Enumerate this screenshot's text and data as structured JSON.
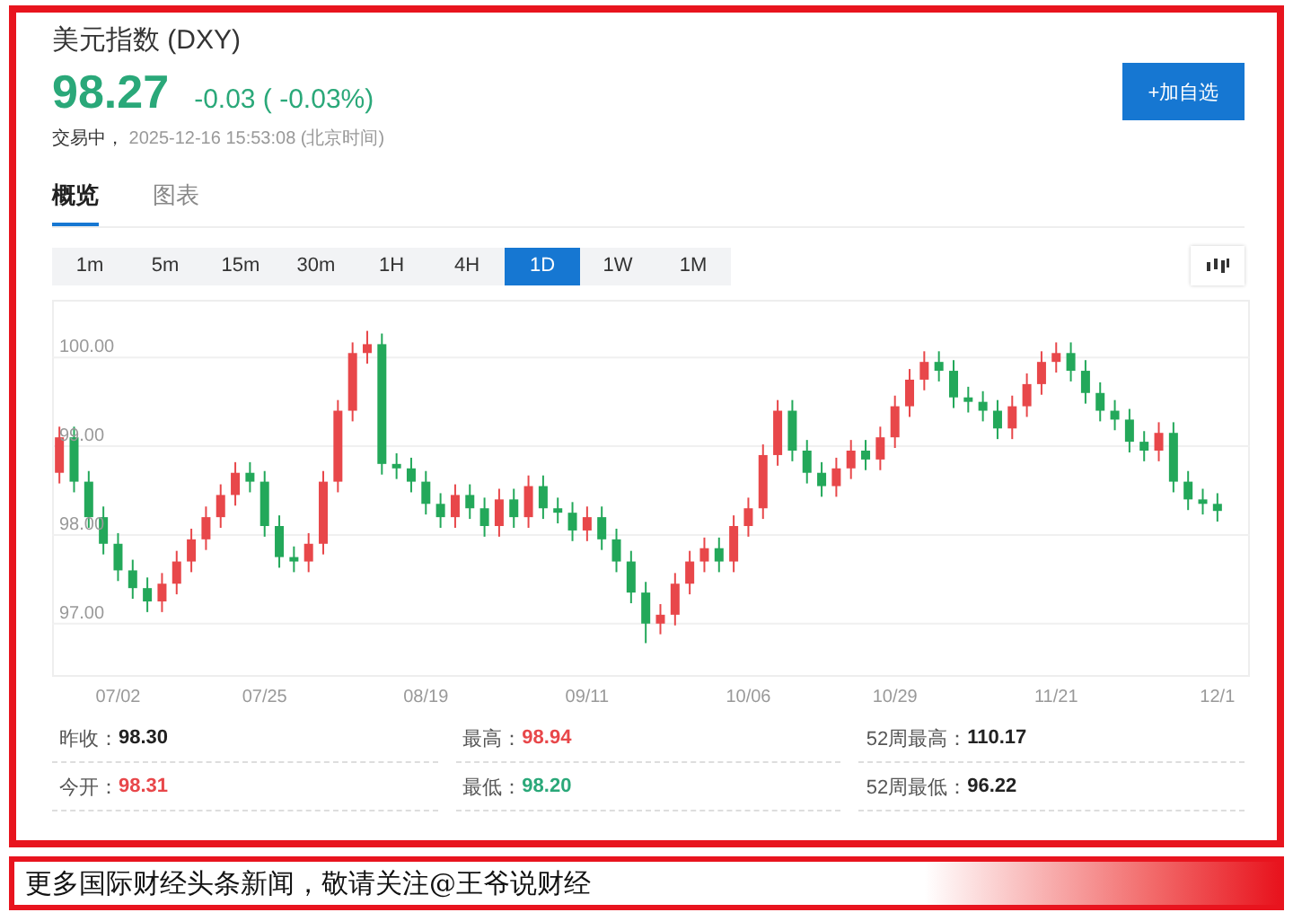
{
  "header": {
    "title": "美元指数 (DXY)",
    "price": "98.27",
    "change": "-0.03 ( -0.03%)",
    "status": "交易中，",
    "timestamp": "2025-12-16 15:53:08 (北京时间)",
    "add_button": "+加自选"
  },
  "tabs": [
    {
      "label": "概览",
      "selected": true
    },
    {
      "label": "图表",
      "selected": false
    }
  ],
  "periods": [
    {
      "label": "1m",
      "selected": false
    },
    {
      "label": "5m",
      "selected": false
    },
    {
      "label": "15m",
      "selected": false
    },
    {
      "label": "30m",
      "selected": false
    },
    {
      "label": "1H",
      "selected": false
    },
    {
      "label": "4H",
      "selected": false
    },
    {
      "label": "1D",
      "selected": true
    },
    {
      "label": "1W",
      "selected": false
    },
    {
      "label": "1M",
      "selected": false
    }
  ],
  "chart": {
    "chart_data": {
      "type": "candlestick",
      "ylim": [
        96.4,
        100.65
      ],
      "grid": true,
      "categories": [
        null,
        null,
        null,
        null,
        "07/02",
        null,
        null,
        null,
        null,
        null,
        null,
        null,
        null,
        null,
        "07/25",
        null,
        null,
        null,
        null,
        null,
        null,
        null,
        null,
        null,
        null,
        "08/19",
        null,
        null,
        null,
        null,
        null,
        null,
        null,
        null,
        null,
        null,
        "09/11",
        null,
        null,
        null,
        null,
        null,
        null,
        null,
        null,
        null,
        null,
        "10/06",
        null,
        null,
        null,
        null,
        null,
        null,
        null,
        null,
        null,
        "10/29",
        null,
        null,
        null,
        null,
        null,
        null,
        null,
        null,
        null,
        null,
        "11/21",
        null,
        null,
        null,
        null,
        null,
        null,
        null,
        null,
        null,
        null,
        "12/1"
      ],
      "ohlc": [
        [
          98.7,
          99.22,
          98.58,
          99.1
        ],
        [
          99.1,
          99.22,
          98.48,
          98.6
        ],
        [
          98.6,
          98.72,
          98.08,
          98.2
        ],
        [
          98.2,
          98.32,
          97.78,
          97.9
        ],
        [
          97.9,
          98.02,
          97.48,
          97.6
        ],
        [
          97.6,
          97.72,
          97.28,
          97.4
        ],
        [
          97.4,
          97.52,
          97.13,
          97.25
        ],
        [
          97.25,
          97.57,
          97.13,
          97.45
        ],
        [
          97.45,
          97.82,
          97.33,
          97.7
        ],
        [
          97.7,
          98.07,
          97.58,
          97.95
        ],
        [
          97.95,
          98.32,
          97.83,
          98.2
        ],
        [
          98.2,
          98.57,
          98.08,
          98.45
        ],
        [
          98.45,
          98.82,
          98.33,
          98.7
        ],
        [
          98.7,
          98.82,
          98.48,
          98.6
        ],
        [
          98.6,
          98.72,
          97.98,
          98.1
        ],
        [
          98.1,
          98.22,
          97.63,
          97.75
        ],
        [
          97.75,
          97.87,
          97.58,
          97.7
        ],
        [
          97.7,
          98.02,
          97.58,
          97.9
        ],
        [
          97.9,
          98.72,
          97.78,
          98.6
        ],
        [
          98.6,
          99.52,
          98.48,
          99.4
        ],
        [
          99.4,
          100.17,
          99.28,
          100.05
        ],
        [
          100.05,
          100.3,
          99.93,
          100.15
        ],
        [
          100.15,
          100.27,
          98.68,
          98.8
        ],
        [
          98.8,
          98.92,
          98.63,
          98.75
        ],
        [
          98.75,
          98.87,
          98.48,
          98.6
        ],
        [
          98.6,
          98.72,
          98.23,
          98.35
        ],
        [
          98.35,
          98.47,
          98.08,
          98.2
        ],
        [
          98.2,
          98.57,
          98.08,
          98.45
        ],
        [
          98.45,
          98.57,
          98.18,
          98.3
        ],
        [
          98.3,
          98.42,
          97.98,
          98.1
        ],
        [
          98.1,
          98.52,
          97.98,
          98.4
        ],
        [
          98.4,
          98.52,
          98.08,
          98.2
        ],
        [
          98.2,
          98.67,
          98.08,
          98.55
        ],
        [
          98.55,
          98.67,
          98.18,
          98.3
        ],
        [
          98.3,
          98.42,
          98.13,
          98.25
        ],
        [
          98.25,
          98.37,
          97.93,
          98.05
        ],
        [
          98.05,
          98.32,
          97.93,
          98.2
        ],
        [
          98.2,
          98.32,
          97.83,
          97.95
        ],
        [
          97.95,
          98.07,
          97.58,
          97.7
        ],
        [
          97.7,
          97.82,
          97.23,
          97.35
        ],
        [
          97.35,
          97.47,
          96.78,
          97.0
        ],
        [
          97.0,
          97.22,
          96.88,
          97.1
        ],
        [
          97.1,
          97.57,
          96.98,
          97.45
        ],
        [
          97.45,
          97.82,
          97.33,
          97.7
        ],
        [
          97.7,
          97.97,
          97.58,
          97.85
        ],
        [
          97.85,
          97.97,
          97.58,
          97.7
        ],
        [
          97.7,
          98.22,
          97.58,
          98.1
        ],
        [
          98.1,
          98.42,
          97.98,
          98.3
        ],
        [
          98.3,
          99.02,
          98.18,
          98.9
        ],
        [
          98.9,
          99.52,
          98.78,
          99.4
        ],
        [
          99.4,
          99.52,
          98.83,
          98.95
        ],
        [
          98.95,
          99.07,
          98.58,
          98.7
        ],
        [
          98.7,
          98.82,
          98.43,
          98.55
        ],
        [
          98.55,
          98.87,
          98.43,
          98.75
        ],
        [
          98.75,
          99.07,
          98.63,
          98.95
        ],
        [
          98.95,
          99.07,
          98.73,
          98.85
        ],
        [
          98.85,
          99.22,
          98.73,
          99.1
        ],
        [
          99.1,
          99.57,
          98.98,
          99.45
        ],
        [
          99.45,
          99.87,
          99.33,
          99.75
        ],
        [
          99.75,
          100.07,
          99.63,
          99.95
        ],
        [
          99.95,
          100.07,
          99.73,
          99.85
        ],
        [
          99.85,
          99.97,
          99.43,
          99.55
        ],
        [
          99.55,
          99.67,
          99.38,
          99.5
        ],
        [
          99.5,
          99.62,
          99.28,
          99.4
        ],
        [
          99.4,
          99.52,
          99.08,
          99.2
        ],
        [
          99.2,
          99.57,
          99.08,
          99.45
        ],
        [
          99.45,
          99.82,
          99.33,
          99.7
        ],
        [
          99.7,
          100.07,
          99.58,
          99.95
        ],
        [
          99.95,
          100.17,
          99.83,
          100.05
        ],
        [
          100.05,
          100.17,
          99.73,
          99.85
        ],
        [
          99.85,
          99.97,
          99.48,
          99.6
        ],
        [
          99.6,
          99.72,
          99.28,
          99.4
        ],
        [
          99.4,
          99.52,
          99.18,
          99.3
        ],
        [
          99.3,
          99.42,
          98.93,
          99.05
        ],
        [
          99.05,
          99.17,
          98.83,
          98.95
        ],
        [
          98.95,
          99.27,
          98.83,
          99.15
        ],
        [
          99.15,
          99.27,
          98.48,
          98.6
        ],
        [
          98.6,
          98.72,
          98.28,
          98.4
        ],
        [
          98.4,
          98.52,
          98.23,
          98.35
        ],
        [
          98.35,
          98.47,
          98.15,
          98.27
        ]
      ],
      "yticks": [
        {
          "value": 100,
          "label": "100.00"
        },
        {
          "value": 99,
          "label": "99.00"
        },
        {
          "value": 98,
          "label": "98.00"
        },
        {
          "value": 97,
          "label": "97.00"
        }
      ]
    }
  },
  "stats": [
    {
      "label": "昨收：",
      "value": "98.30",
      "color": "#222222"
    },
    {
      "label": "最高：",
      "value": "98.94",
      "color": "#e8474a"
    },
    {
      "label": "52周最高：",
      "value": "110.17",
      "color": "#222222"
    },
    {
      "label": "今开：",
      "value": "98.31",
      "color": "#e8474a"
    },
    {
      "label": "最低：",
      "value": "98.20",
      "color": "#2aa879"
    },
    {
      "label": "52周最低：",
      "value": "96.22",
      "color": "#222222"
    }
  ],
  "banner": "更多国际财经头条新闻，敬请关注@王爷说财经"
}
